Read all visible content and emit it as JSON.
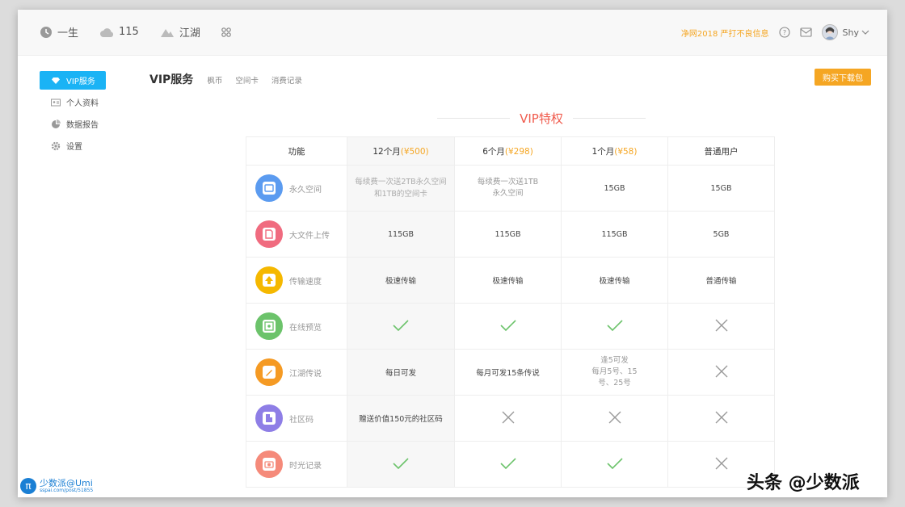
{
  "header": {
    "nav": [
      {
        "label": "一生",
        "icon": "clock-icon"
      },
      {
        "label": "115",
        "icon": "cloud-icon"
      },
      {
        "label": "江湖",
        "icon": "mountain-icon"
      },
      {
        "label": "",
        "icon": "grid-icon"
      }
    ],
    "notice": "净网2018 严打不良信息",
    "user": "Shy"
  },
  "sidebar": {
    "items": [
      {
        "label": "VIP服务",
        "icon": "diamond-icon"
      },
      {
        "label": "个人资料",
        "icon": "id-card-icon"
      },
      {
        "label": "数据报告",
        "icon": "pie-chart-icon"
      },
      {
        "label": "设置",
        "icon": "gear-icon"
      }
    ]
  },
  "tabs": {
    "main": "VIP服务",
    "items": [
      "枫币",
      "空间卡",
      "消费记录"
    ]
  },
  "buy_button": "购买下载包",
  "section_title": "VIP特权",
  "table": {
    "headers": {
      "feature": "功能",
      "plan12": {
        "name": "12个月",
        "price": "(¥500)"
      },
      "plan6": {
        "name": "6个月",
        "price": "(¥298)"
      },
      "plan1": {
        "name": "1个月",
        "price": "(¥58)"
      },
      "normal": "普通用户"
    },
    "rows": [
      {
        "name": "永久空间",
        "icon": "disk-icon",
        "color": "#5b9bf0",
        "c1": [
          "每续费一次送2TB永久空间",
          "和1TB的空间卡"
        ],
        "c2": [
          "每续费一次送1TB",
          "永久空间"
        ],
        "c3": [
          "15GB"
        ],
        "c4": [
          "15GB"
        ]
      },
      {
        "name": "大文件上传",
        "icon": "file-upload-icon",
        "color": "#f06b7f",
        "c1": [
          "115GB"
        ],
        "c2": [
          "115GB"
        ],
        "c3": [
          "115GB"
        ],
        "c4": [
          "5GB"
        ]
      },
      {
        "name": "传输速度",
        "icon": "arrow-up-icon",
        "color": "#f5b800",
        "c1": [
          "极速传输"
        ],
        "c2": [
          "极速传输"
        ],
        "c3": [
          "极速传输"
        ],
        "c4": [
          "普通传输"
        ]
      },
      {
        "name": "在线预览",
        "icon": "preview-icon",
        "color": "#6cc36b",
        "c1": "check",
        "c2": "check",
        "c3": "check",
        "c4": "cross"
      },
      {
        "name": "江湖传说",
        "icon": "edit-icon",
        "color": "#f59a23",
        "c1": [
          "每日可发"
        ],
        "c2": [
          "每月可发15条传说"
        ],
        "c3": [
          "逢5可发",
          "每月5号、15",
          "号、25号"
        ],
        "c4": "cross"
      },
      {
        "name": "社区码",
        "icon": "building-icon",
        "color": "#8e7ee6",
        "c1": [
          "赠送价值150元的社区码"
        ],
        "c2": "cross",
        "c3": "cross",
        "c4": "cross"
      },
      {
        "name": "时光记录",
        "icon": "camera-icon",
        "color": "#f58a7a",
        "c1": "check",
        "c2": "check",
        "c3": "check",
        "c4": "cross"
      }
    ]
  },
  "watermark": {
    "left_title": "少数派@Umi",
    "left_sub": "sspai.com/post/51855",
    "right": "头条 @少数派"
  }
}
